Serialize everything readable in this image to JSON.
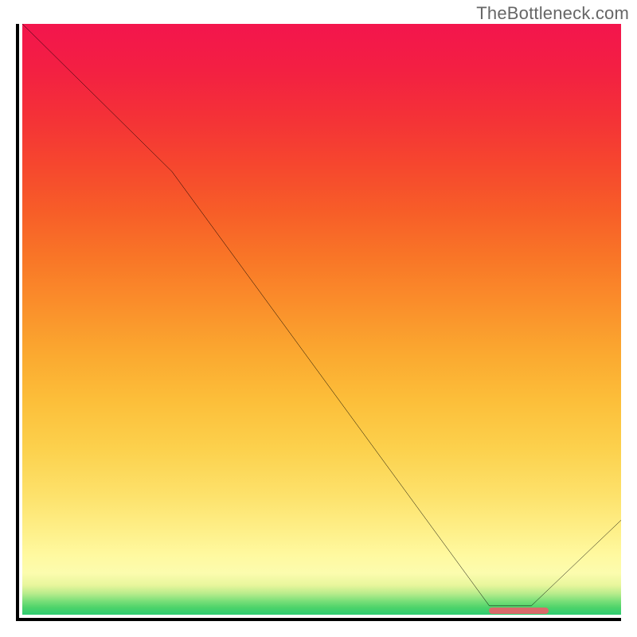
{
  "watermark": "TheBottleneck.com",
  "chart_data": {
    "type": "line",
    "title": "",
    "xlabel": "",
    "ylabel": "",
    "xlim": [
      0,
      100
    ],
    "ylim": [
      0,
      100
    ],
    "grid": false,
    "curve": {
      "x": [
        0,
        25,
        78,
        85,
        100
      ],
      "y": [
        100,
        75,
        1.5,
        1.5,
        16
      ]
    },
    "gradient_stops": [
      {
        "pos": 0.0,
        "color": "#2ecc71"
      },
      {
        "pos": 0.05,
        "color": "#e8f69c"
      },
      {
        "pos": 0.1,
        "color": "#fff9a0"
      },
      {
        "pos": 0.3,
        "color": "#fcd14d"
      },
      {
        "pos": 0.55,
        "color": "#fa902b"
      },
      {
        "pos": 0.8,
        "color": "#f6472e"
      },
      {
        "pos": 1.0,
        "color": "#f3154d"
      }
    ],
    "optimum_marker": {
      "x_start": 78,
      "x_end": 88,
      "color": "#d96a6a"
    }
  }
}
